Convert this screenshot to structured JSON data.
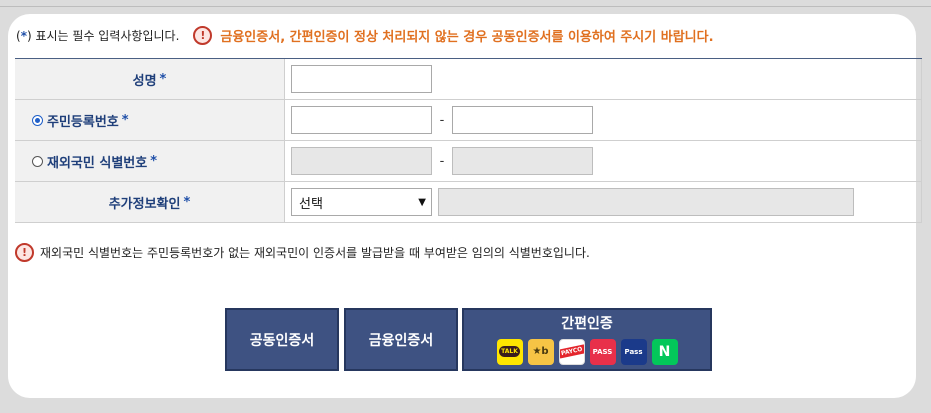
{
  "notice": {
    "legend_open": "(",
    "legend_star": "*",
    "legend_rest": ") 표시는 필수 입력사항입니다.",
    "warning": "금융인증서, 간편인증이 정상 처리되지 않는 경우 공동인증서를 이용하여 주시기 바랍니다."
  },
  "form": {
    "required_mark": "*",
    "name_label": "성명",
    "rrn_label": "주민등록번호",
    "foreign_label": "재외국민 식별번호",
    "extra_label": "추가정보확인",
    "separator": "-",
    "rrn_selected": true,
    "select_value": "선택"
  },
  "footnote": "재외국민 식별번호는 주민등록번호가 없는 재외국민이 인증서를 발급받을 때 부여받은 임의의 식별번호입니다.",
  "buttons": {
    "joint_cert": "공동인증서",
    "financial_cert": "금융인증서",
    "simple_auth": "간편인증"
  },
  "simple_auth_providers": [
    {
      "icon": "kakaotalk-icon",
      "text": "TALK"
    },
    {
      "icon": "kb-icon",
      "text": "★b"
    },
    {
      "icon": "payco-icon",
      "text": "PAYCO"
    },
    {
      "icon": "pass-icon",
      "text": "PASS"
    },
    {
      "icon": "samsung-pass-icon",
      "text": "Pass"
    },
    {
      "icon": "naver-icon",
      "text": "N"
    }
  ],
  "colors": {
    "button_bg": "#3e5282",
    "warning_text": "#e07020",
    "label_text": "#1f3f7a",
    "alert_red": "#c0392b"
  }
}
